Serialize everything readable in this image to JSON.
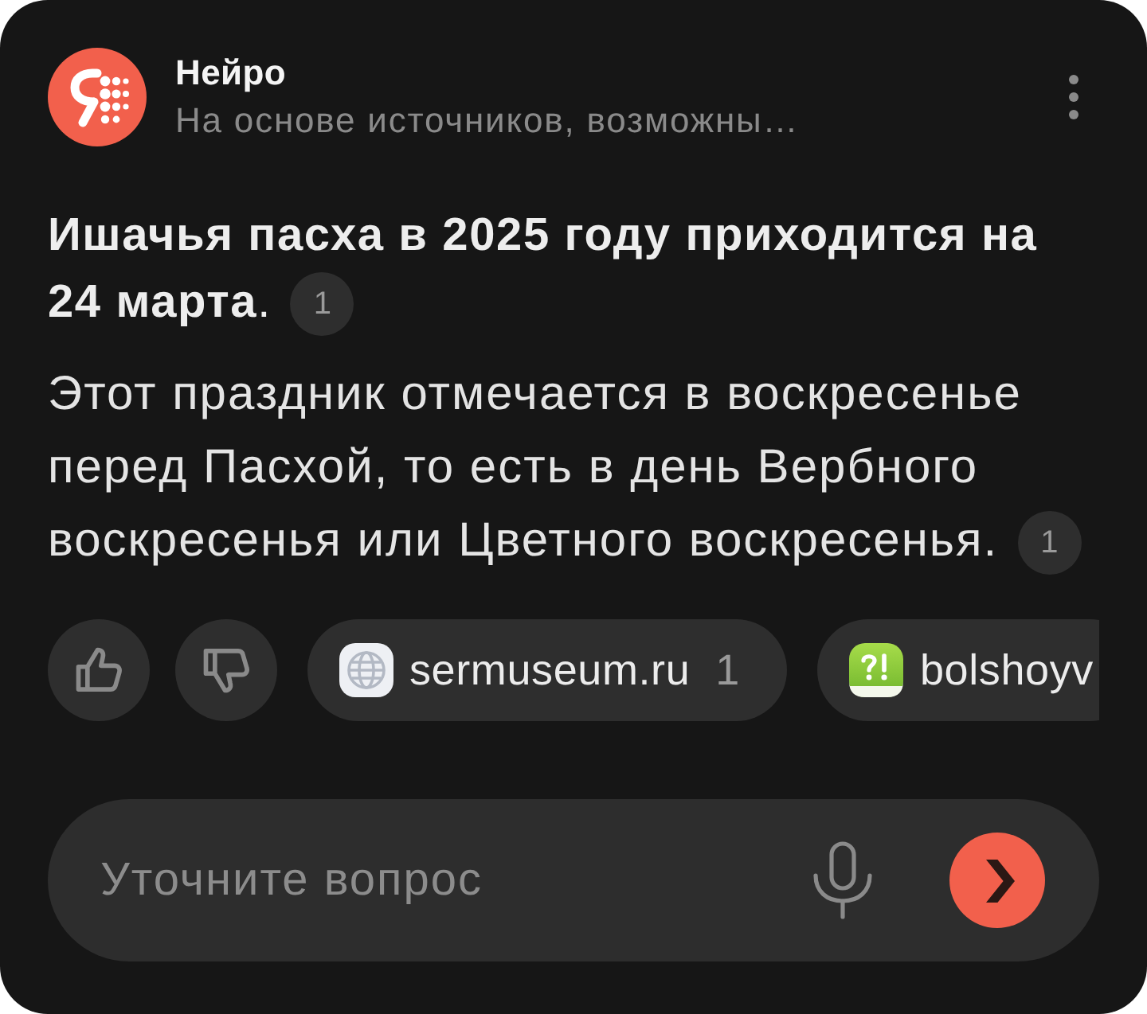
{
  "header": {
    "title": "Нейро",
    "subtitle": "На основе источников, возможны…"
  },
  "answer": {
    "headline": "**Ишачья пасха в 2025 году приходится на 24 марта**.",
    "headline_citation": "1",
    "paragraph": "Этот праздник отмечается в воскресенье перед Пасхой, то есть в день Вербного воскресенья или Цветного воскресенья.",
    "paragraph_citation": "1"
  },
  "feedback": [
    {
      "kind": "like",
      "selected": false
    },
    {
      "kind": "dislike",
      "selected": false
    }
  ],
  "sources": [
    {
      "kind": "globe",
      "domain": "sermuseum.ru",
      "count": "1"
    },
    {
      "kind": "green",
      "domain": "bolshoyv"
    }
  ],
  "input": {
    "placeholder": "Уточните вопрос"
  }
}
